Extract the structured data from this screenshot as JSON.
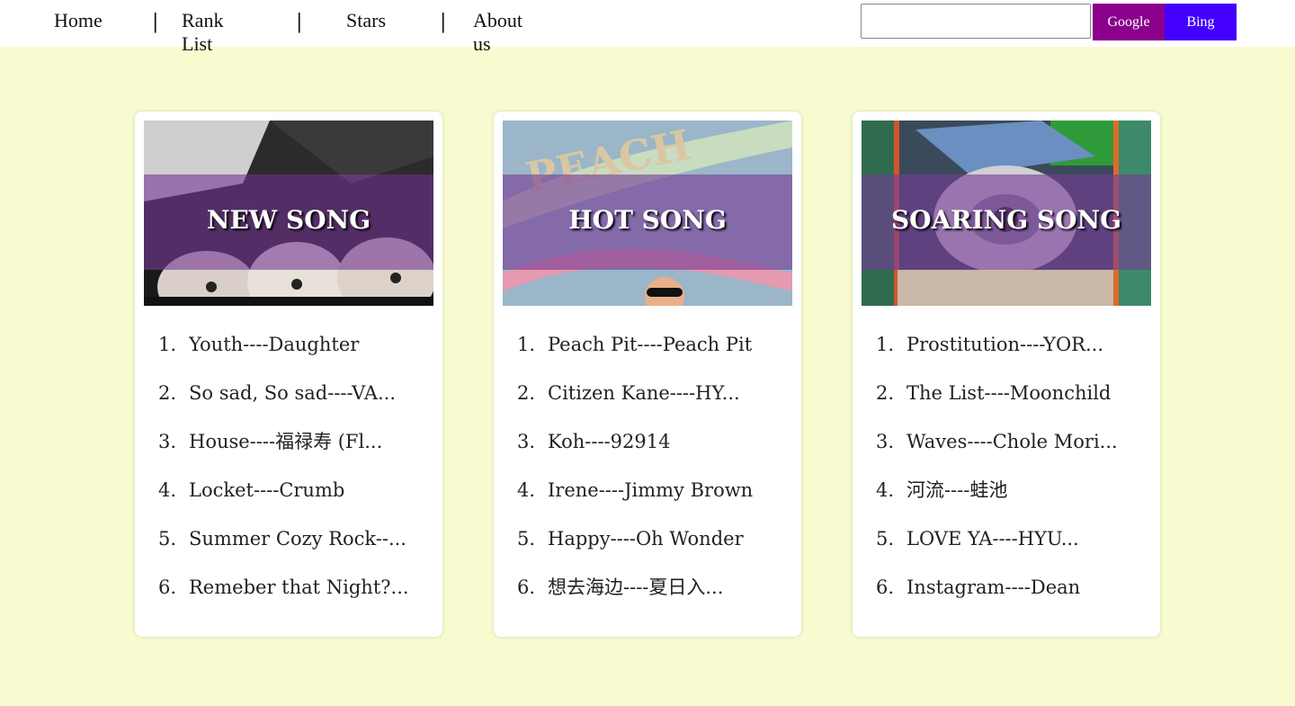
{
  "nav": {
    "home": "Home",
    "rank_list": "Rank List",
    "stars": "Stars",
    "about": "About us",
    "separator": "|"
  },
  "search": {
    "value": "",
    "google_label": "Google",
    "bing_label": "Bing"
  },
  "cards": [
    {
      "title": "NEW SONG",
      "songs": [
        {
          "num": "1.",
          "text": "Youth----Daughter"
        },
        {
          "num": "2.",
          "text": "So sad, So sad----VA..."
        },
        {
          "num": "3.",
          "text": "House----福禄寿 (Fl..."
        },
        {
          "num": "4.",
          "text": "Locket----Crumb"
        },
        {
          "num": "5.",
          "text": "Summer Cozy Rock--..."
        },
        {
          "num": "6.",
          "text": "Remeber that Night?..."
        }
      ]
    },
    {
      "title": "HOT SONG",
      "songs": [
        {
          "num": "1.",
          "text": "Peach Pit----Peach Pit"
        },
        {
          "num": "2.",
          "text": "Citizen Kane----HY..."
        },
        {
          "num": "3.",
          "text": "Koh----92914"
        },
        {
          "num": "4.",
          "text": "Irene----Jimmy Brown"
        },
        {
          "num": "5.",
          "text": "Happy----Oh Wonder"
        },
        {
          "num": "6.",
          "text": "想去海边----夏日入..."
        }
      ]
    },
    {
      "title": "SOARING SONG",
      "songs": [
        {
          "num": "1.",
          "text": "Prostitution----YOR..."
        },
        {
          "num": "2.",
          "text": "The List----Moonchild"
        },
        {
          "num": "3.",
          "text": "Waves----Chole Mori..."
        },
        {
          "num": "4.",
          "text": "河流----蛙池"
        },
        {
          "num": "5.",
          "text": "LOVE YA----HYU..."
        },
        {
          "num": "6.",
          "text": "Instagram----Dean"
        }
      ]
    }
  ],
  "colors": {
    "page_bg": "#f8fbcf",
    "google_button": "#8a008a",
    "bing_button": "#4400ff",
    "band_overlay": "#783c96"
  }
}
